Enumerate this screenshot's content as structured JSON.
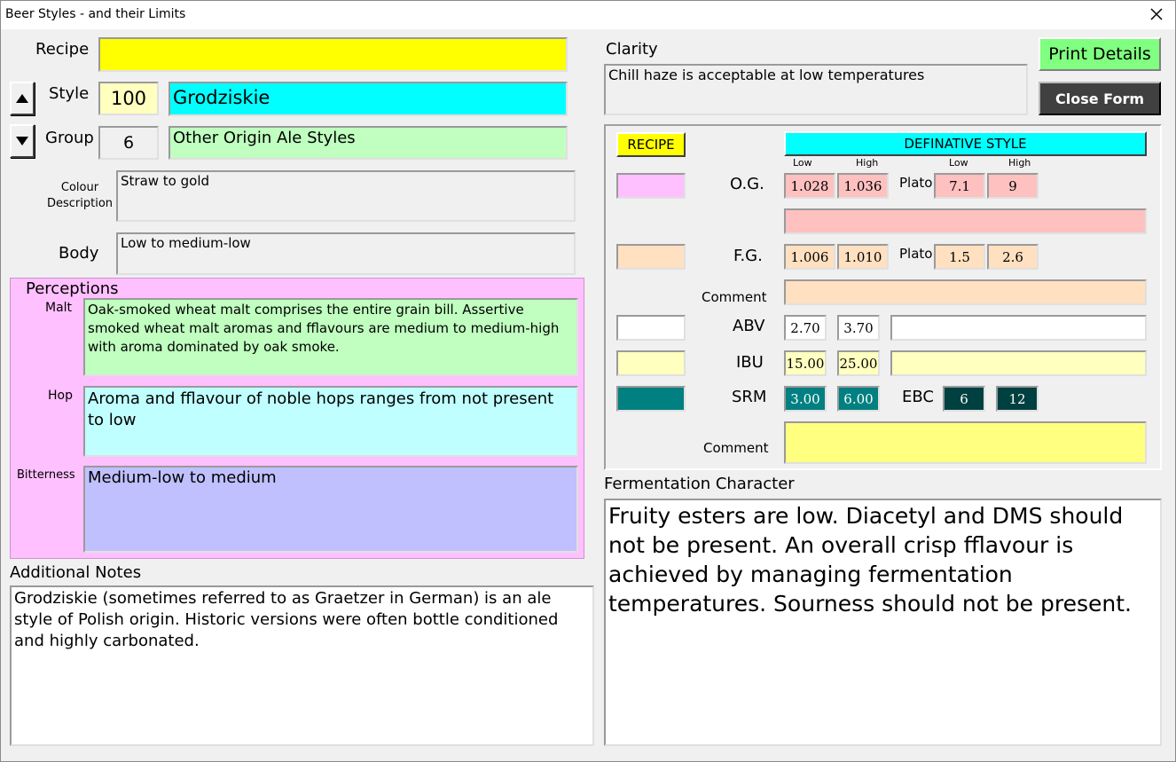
{
  "window": {
    "title": "Beer Styles - and their Limits"
  },
  "left": {
    "recipe_label": "Recipe",
    "recipe_value": "",
    "style_label": "Style",
    "style_number": "100",
    "style_name": "Grodziskie",
    "group_label": "Group",
    "group_number": "6",
    "group_name": "Other Origin Ale Styles",
    "colour_label": "Colour Description",
    "colour_value": "Straw to gold",
    "body_label": "Body",
    "body_value": "Low to medium-low",
    "perceptions_label": "Perceptions",
    "malt_label": "Malt",
    "malt_value": "Oak-smoked wheat malt comprises the entire grain bill. Assertive smoked wheat malt aromas and fflavours are medium to medium-high with aroma dominated by oak smoke.",
    "hop_label": "Hop",
    "hop_value": "Aroma and fflavour of noble hops ranges from not present to low",
    "bitterness_label": "Bitterness",
    "bitterness_value": "Medium-low to medium",
    "notes_label": "Additional Notes",
    "notes_value": "Grodziskie (sometimes referred to as Graetzer in German) is an ale style of Polish origin. Historic versions were often bottle conditioned and highly carbonated."
  },
  "right": {
    "clarity_label": "Clarity",
    "clarity_value": "Chill haze is acceptable at low temperatures",
    "print_button": "Print Details",
    "close_button": "Close Form",
    "recipe_header": "RECIPE",
    "style_header": "DEFINATIVE STYLE",
    "low": "Low",
    "high": "High",
    "og_label": "O.G.",
    "og_low": "1.028",
    "og_high": "1.036",
    "plato_label": "Plato",
    "og_plato_low": "7.1",
    "og_plato_high": "9",
    "fg_label": "F.G.",
    "fg_low": "1.006",
    "fg_high": "1.010",
    "fg_plato_low": "1.5",
    "fg_plato_high": "2.6",
    "comment_label": "Comment",
    "abv_label": "ABV",
    "abv_low": "2.70",
    "abv_high": "3.70",
    "ibu_label": "IBU",
    "ibu_low": "15.00",
    "ibu_high": "25.00",
    "srm_label": "SRM",
    "srm_low": "3.00",
    "srm_high": "6.00",
    "ebc_label": "EBC",
    "ebc_low": "6",
    "ebc_high": "12",
    "fermentation_label": "Fermentation Character",
    "fermentation_value": "Fruity esters are low. Diacetyl and DMS should not be present. An overall crisp fflavour is achieved by managing fermentation temperatures. Sourness should not be present."
  },
  "icons": {
    "close": "close-icon",
    "up": "arrow-up-icon",
    "down": "arrow-down-icon"
  }
}
